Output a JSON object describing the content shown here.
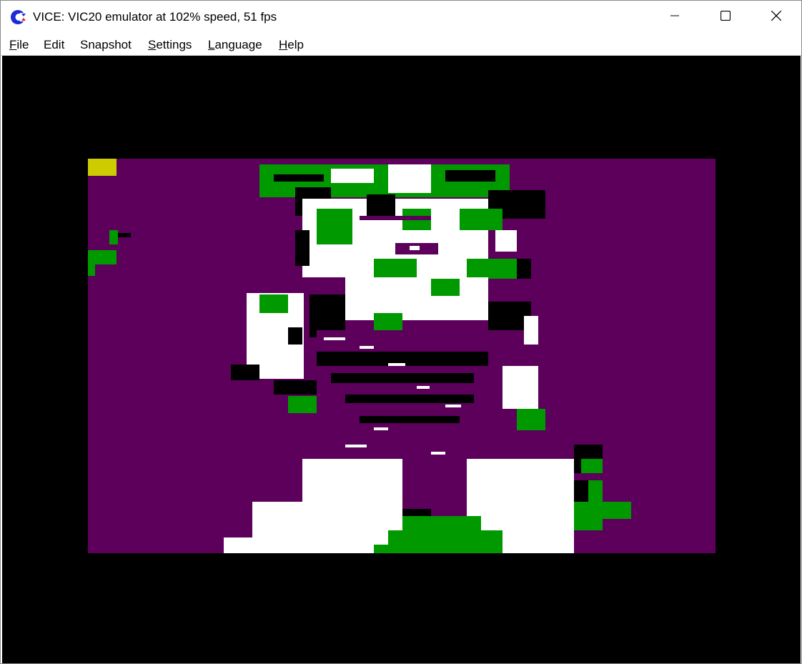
{
  "window": {
    "title": "VICE: VIC20 emulator at 102% speed, 51 fps",
    "icon": "commodore-logo-icon",
    "controls": {
      "minimize_icon": "minimize-icon",
      "maximize_icon": "maximize-icon",
      "close_icon": "close-icon"
    }
  },
  "menu": {
    "items": [
      {
        "label": "File",
        "mnemonic": "F",
        "rest": "ile"
      },
      {
        "label": "Edit",
        "mnemonic": "",
        "rest": "Edit"
      },
      {
        "label": "Snapshot",
        "mnemonic": "Sna",
        "rest": "pshot"
      },
      {
        "label": "Settings",
        "mnemonic": "S",
        "rest": "ettings"
      },
      {
        "label": "Language",
        "mnemonic": "L",
        "rest": "anguage"
      },
      {
        "label": "Help",
        "mnemonic": "H",
        "rest": "elp"
      }
    ]
  },
  "display": {
    "border_color": "#000000",
    "screen_color": "#5c005c",
    "palette": {
      "purple": "#5c005c",
      "green": "#009900",
      "white": "#ffffff",
      "black": "#000000",
      "yellow": "#cccc00"
    },
    "content": "vic20-pixel-art-portrait"
  }
}
